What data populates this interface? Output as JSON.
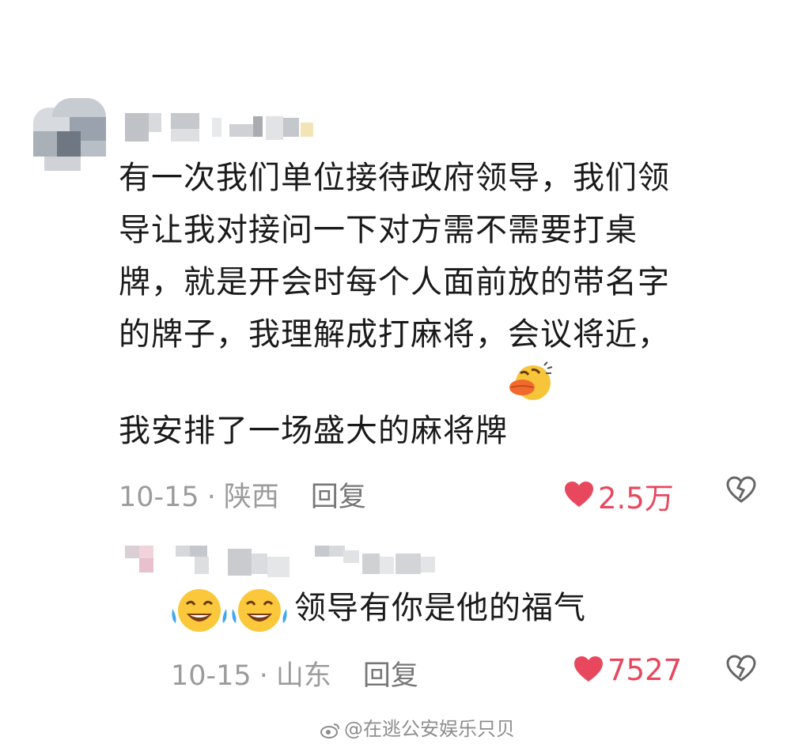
{
  "comment": {
    "text": "有一次我们单位接待政府领导，我们领\n导让我对接问一下对方需不需要打桌\n牌，就是开会时每个人面前放的带名字\n的牌子，我理解成打麻将，会议将近，\n我安排了一场盛大的麻将牌",
    "date": "10-15",
    "location": "陕西",
    "reply_label": "回复",
    "likes": "2.5万",
    "emoji": "laughing-duck-emoji"
  },
  "reply": {
    "text": "领导有你是他的福气",
    "date": "10-15",
    "location": "山东",
    "reply_label": "回复",
    "likes": "7527",
    "emoji": "tears-of-joy-emoji"
  },
  "meta_separator": "·",
  "watermark": "@在逃公安娱乐只贝",
  "colors": {
    "like_red": "#e8485d",
    "meta_gray": "#9b9b9b",
    "text": "#1a1a1a"
  },
  "icons": [
    "heart-icon",
    "broken-heart-icon",
    "weibo-logo-icon"
  ]
}
